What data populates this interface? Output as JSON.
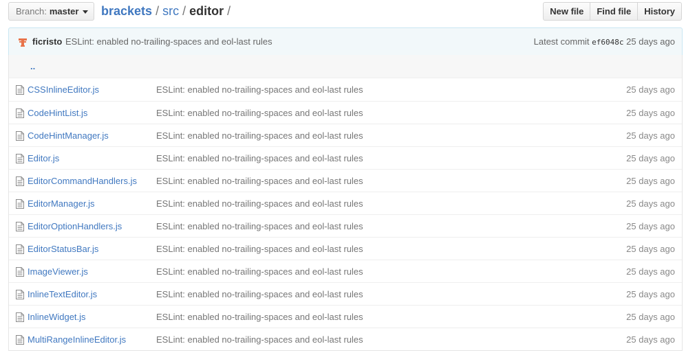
{
  "branch": {
    "prefix": "Branch:",
    "name": "master"
  },
  "breadcrumb": {
    "repo": "brackets",
    "sep1": "/",
    "folder": "src",
    "sep2": "/",
    "current": "editor",
    "sep3": "/"
  },
  "actions": {
    "new_file": "New file",
    "find_file": "Find file",
    "history": "History"
  },
  "latest_commit": {
    "author": "ficristo",
    "message": "ESLint: enabled no-trailing-spaces and eol-last rules",
    "label": "Latest commit",
    "sha": "ef6048c",
    "age": "25 days ago"
  },
  "up_link": "..",
  "files": [
    {
      "name": "CSSInlineEditor.js",
      "message": "ESLint: enabled no-trailing-spaces and eol-last rules",
      "age": "25 days ago"
    },
    {
      "name": "CodeHintList.js",
      "message": "ESLint: enabled no-trailing-spaces and eol-last rules",
      "age": "25 days ago"
    },
    {
      "name": "CodeHintManager.js",
      "message": "ESLint: enabled no-trailing-spaces and eol-last rules",
      "age": "25 days ago"
    },
    {
      "name": "Editor.js",
      "message": "ESLint: enabled no-trailing-spaces and eol-last rules",
      "age": "25 days ago"
    },
    {
      "name": "EditorCommandHandlers.js",
      "message": "ESLint: enabled no-trailing-spaces and eol-last rules",
      "age": "25 days ago"
    },
    {
      "name": "EditorManager.js",
      "message": "ESLint: enabled no-trailing-spaces and eol-last rules",
      "age": "25 days ago"
    },
    {
      "name": "EditorOptionHandlers.js",
      "message": "ESLint: enabled no-trailing-spaces and eol-last rules",
      "age": "25 days ago"
    },
    {
      "name": "EditorStatusBar.js",
      "message": "ESLint: enabled no-trailing-spaces and eol-last rules",
      "age": "25 days ago"
    },
    {
      "name": "ImageViewer.js",
      "message": "ESLint: enabled no-trailing-spaces and eol-last rules",
      "age": "25 days ago"
    },
    {
      "name": "InlineTextEditor.js",
      "message": "ESLint: enabled no-trailing-spaces and eol-last rules",
      "age": "25 days ago"
    },
    {
      "name": "InlineWidget.js",
      "message": "ESLint: enabled no-trailing-spaces and eol-last rules",
      "age": "25 days ago"
    },
    {
      "name": "MultiRangeInlineEditor.js",
      "message": "ESLint: enabled no-trailing-spaces and eol-last rules",
      "age": "25 days ago"
    }
  ],
  "icons": {
    "file": "file-text-icon",
    "caret": "caret-down-icon",
    "avatar": "user-avatar"
  },
  "colors": {
    "link": "#4078c0",
    "commit_bg": "#f2f8fa",
    "commit_border": "#c9e6f2",
    "avatar": "#e8734a"
  }
}
